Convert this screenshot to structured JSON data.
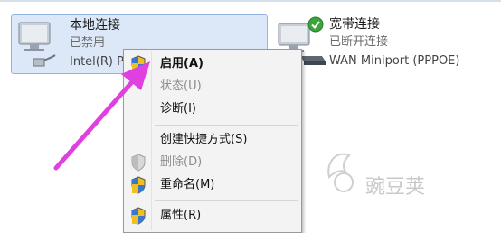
{
  "connections": {
    "local": {
      "name": "本地连接",
      "status": "已禁用",
      "device": "Intel(R) P"
    },
    "broadband": {
      "name": "宽带连接",
      "status": "已断开连接",
      "device": "WAN Miniport (PPPOE)"
    }
  },
  "context_menu": {
    "items": [
      {
        "label": "启用(A)",
        "icon": "shield-icon",
        "bold": true,
        "enabled": true
      },
      {
        "label": "状态(U)",
        "icon": "",
        "bold": false,
        "enabled": false
      },
      {
        "label": "诊断(I)",
        "icon": "",
        "bold": false,
        "enabled": true
      },
      {
        "label": "创建快捷方式(S)",
        "icon": "",
        "bold": false,
        "enabled": true
      },
      {
        "label": "删除(D)",
        "icon": "shield-icon",
        "bold": false,
        "enabled": false
      },
      {
        "label": "重命名(M)",
        "icon": "shield-icon",
        "bold": false,
        "enabled": true
      },
      {
        "label": "属性(R)",
        "icon": "shield-icon",
        "bold": false,
        "enabled": true
      }
    ]
  },
  "annotation": {
    "arrow_color": "#e040e0"
  },
  "watermark": {
    "text": "豌豆荚"
  }
}
